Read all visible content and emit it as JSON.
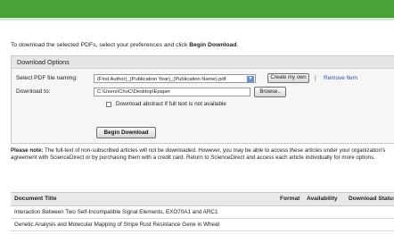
{
  "intro": {
    "before": "To download the selected PDFs, select your preferences and click ",
    "bold": "Begin Download",
    "after": "."
  },
  "options": {
    "title": "Download Options",
    "naming_label": "Select PDF file naming:",
    "naming_value": "(First Author)_(Publication Year)_(Publication Name).pdf",
    "create_own": "Create my own",
    "separator": "|",
    "remove_item": "Remove Item",
    "download_to_label": "Download to:",
    "download_path": "C:\\Users\\ChoC\\Desktop\\Epaper",
    "browse": "Browse..",
    "abstract_checkbox": "Download abstract if full text is not available",
    "abstract_checked": false,
    "begin": "Begin Download"
  },
  "note": {
    "bold": "Please note:",
    "text": " The full-text of non-subscribed articles will not be downloaded. However, you may be able to access these articles under your organization's agreement with ScienceDirect or by purchasing them with a credit card. Return to ScienceDirect and access each article individually for more options."
  },
  "table": {
    "columns": [
      "Document Title",
      "Format",
      "Availability",
      "Download Status"
    ],
    "rows": [
      "Interaction Between Two Self-Incompatible Signal Elements, EXO70A1 and ARC1",
      "Genetic Analysis and Molecular Mapping of Stripe Rust Resistance Gene in Wheat"
    ]
  },
  "colors": {
    "header_bar": "#4aa23a",
    "link": "#2a55a8"
  }
}
